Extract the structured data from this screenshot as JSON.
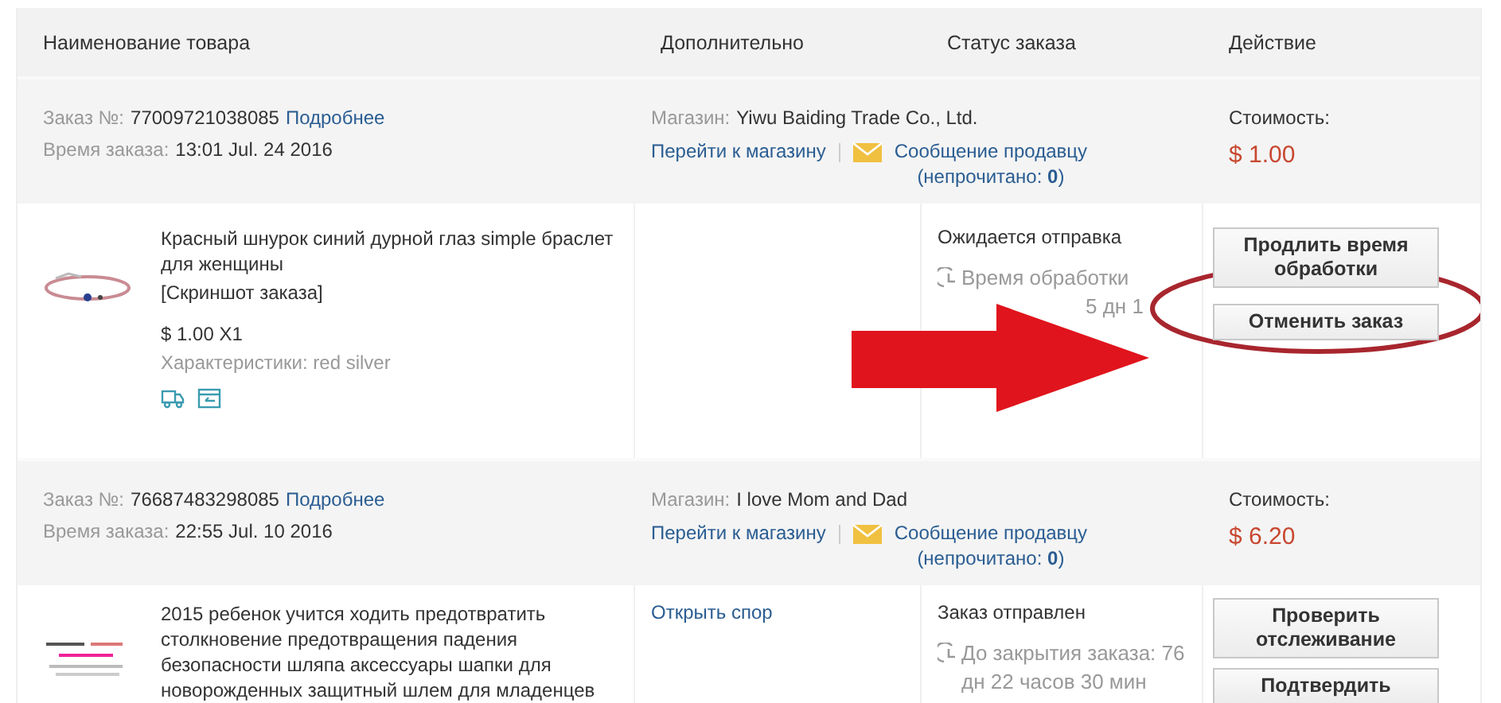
{
  "columns": [
    "Наименование товара",
    "Дополнительно",
    "Статус заказа",
    "Действие"
  ],
  "orders": [
    {
      "order_label": "Заказ №:",
      "number": "77009721038085",
      "details_link": "Подробнее",
      "time_label": "Время заказа:",
      "time": "13:01 Jul. 24 2016",
      "store_label": "Магазин:",
      "store": "Yiwu Baiding Trade Co., Ltd.",
      "store_link": "Перейти к магазину",
      "message_link": "Сообщение продавцу",
      "unread": "(непрочитано: **0**)",
      "cost_label": "Стоимость:",
      "cost": "$ 1.00",
      "item": {
        "picture": {
          "kind": "picture"
        },
        "title": "Красный шнурок синий дурной глаз simple браслет для женщины",
        "snapshot_link": "[Скриншот заказа]",
        "price": "$ 1.00 X1",
        "specs": "Характеристики: red silver",
        "icons": [
          {
            "kind": "truck"
          },
          {
            "kind": "card"
          }
        ],
        "status": "Ожидается отправка",
        "timer": [
          "Время обработки",
          "5 дн 1"
        ],
        "buttons": [
          "Продлить время обработки",
          "Отменить заказ"
        ],
        "highlighted": true
      }
    },
    {
      "order_label": "Заказ №:",
      "number": "76687483298085",
      "details_link": "Подробнее",
      "time_label": "Время заказа:",
      "time": "22:55 Jul. 10 2016",
      "store_label": "Магазин:",
      "store": "I love Mom and Dad",
      "store_link": "Перейти к магазину",
      "message_link": "Сообщение продавцу",
      "unread": "(непрочитано: **0**)",
      "cost_label": "Стоимость:",
      "cost": "$ 6.20",
      "item": {
        "picture": {
          "kind": "picture"
        },
        "title": "2015 ребенок учится ходить предотвратить столкновение предотвращения падения безопасности шляпа аксессуары шапки для новорожденных защитный шлем для младенцев",
        "extra_link": "Открыть спор",
        "status": "Заказ отправлен",
        "timer": [
          "До закрытия заказа: 76 дн 22 часов 30 мин"
        ],
        "buttons": [
          "Проверить отслеживание",
          "Подтвердить"
        ],
        "highlighted": false
      }
    }
  ]
}
